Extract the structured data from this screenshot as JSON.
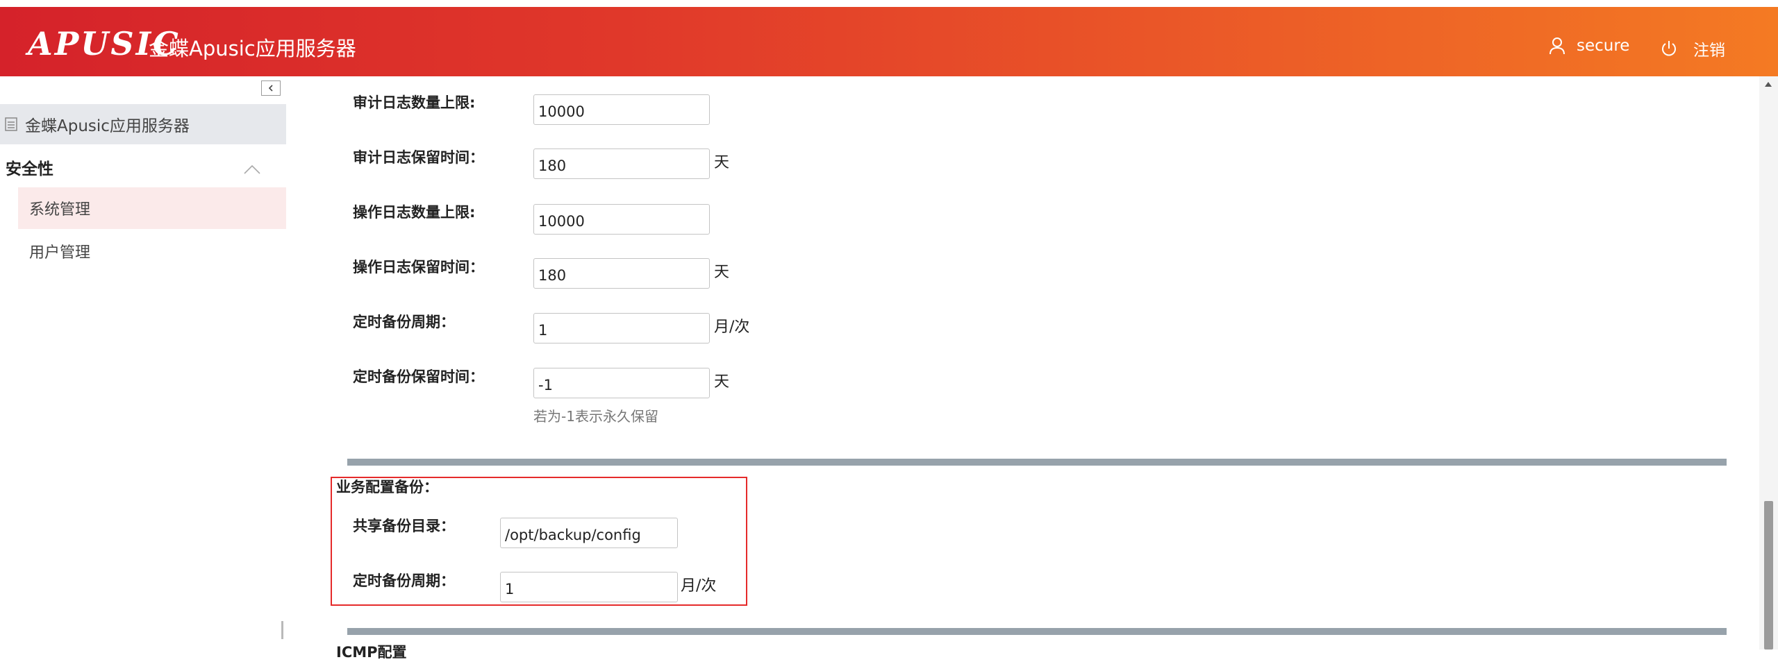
{
  "header": {
    "logo_text": "APUSIC",
    "app_title": "金蝶Apusic应用服务器",
    "user_name": "secure",
    "logout_label": "注销"
  },
  "sidebar": {
    "tree_root": "金蝶Apusic应用服务器",
    "group_label": "安全性",
    "items": [
      {
        "label": "系统管理",
        "active": true
      },
      {
        "label": "用户管理",
        "active": false
      }
    ]
  },
  "form": {
    "audit_log_max": {
      "label": "审计日志数量上限:",
      "value": "10000"
    },
    "audit_log_retention": {
      "label": "审计日志保留时间：",
      "value": "180",
      "unit": "天"
    },
    "operation_log_max": {
      "label": "操作日志数量上限:",
      "value": "10000"
    },
    "operation_log_retention": {
      "label": "操作日志保留时间：",
      "value": "180",
      "unit": "天"
    },
    "backup_period": {
      "label": "定时备份周期：",
      "value": "1",
      "unit": "月/次"
    },
    "backup_retention": {
      "label": "定时备份保留时间：",
      "value": "-1",
      "unit": "天",
      "hint": "若为-1表示永久保留"
    }
  },
  "business_backup": {
    "section_title": "业务配置备份：",
    "shared_dir": {
      "label": "共享备份目录：",
      "value": "/opt/backup/config"
    },
    "period": {
      "label": "定时备份周期：",
      "value": "1",
      "unit": "月/次"
    }
  },
  "next_section_partial": "ICMP配置",
  "colors": {
    "header_gradient_start": "#d5222a",
    "header_gradient_end": "#f47a23",
    "active_item_bg": "#fbeaea",
    "highlight_border": "#e52a2a",
    "section_bar": "#97a2ab"
  }
}
